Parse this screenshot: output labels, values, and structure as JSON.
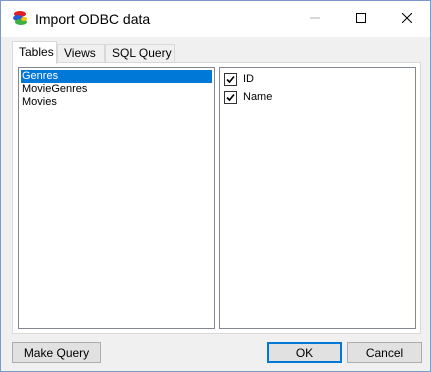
{
  "window": {
    "title": "Import ODBC data",
    "icon": "odbc-app-icon"
  },
  "tabs": [
    {
      "label": "Tables",
      "active": true
    },
    {
      "label": "Views",
      "active": false
    },
    {
      "label": "SQL Query",
      "active": false
    }
  ],
  "tables": {
    "items": [
      "Genres",
      "MovieGenres",
      "Movies"
    ],
    "selected": "Genres"
  },
  "fields": [
    {
      "label": "ID",
      "checked": true
    },
    {
      "label": "Name",
      "checked": true
    }
  ],
  "buttons": {
    "make_query": "Make Query",
    "ok": "OK",
    "cancel": "Cancel"
  },
  "colors": {
    "selection": "#0078d7",
    "window_bg": "#f0f0f0"
  }
}
